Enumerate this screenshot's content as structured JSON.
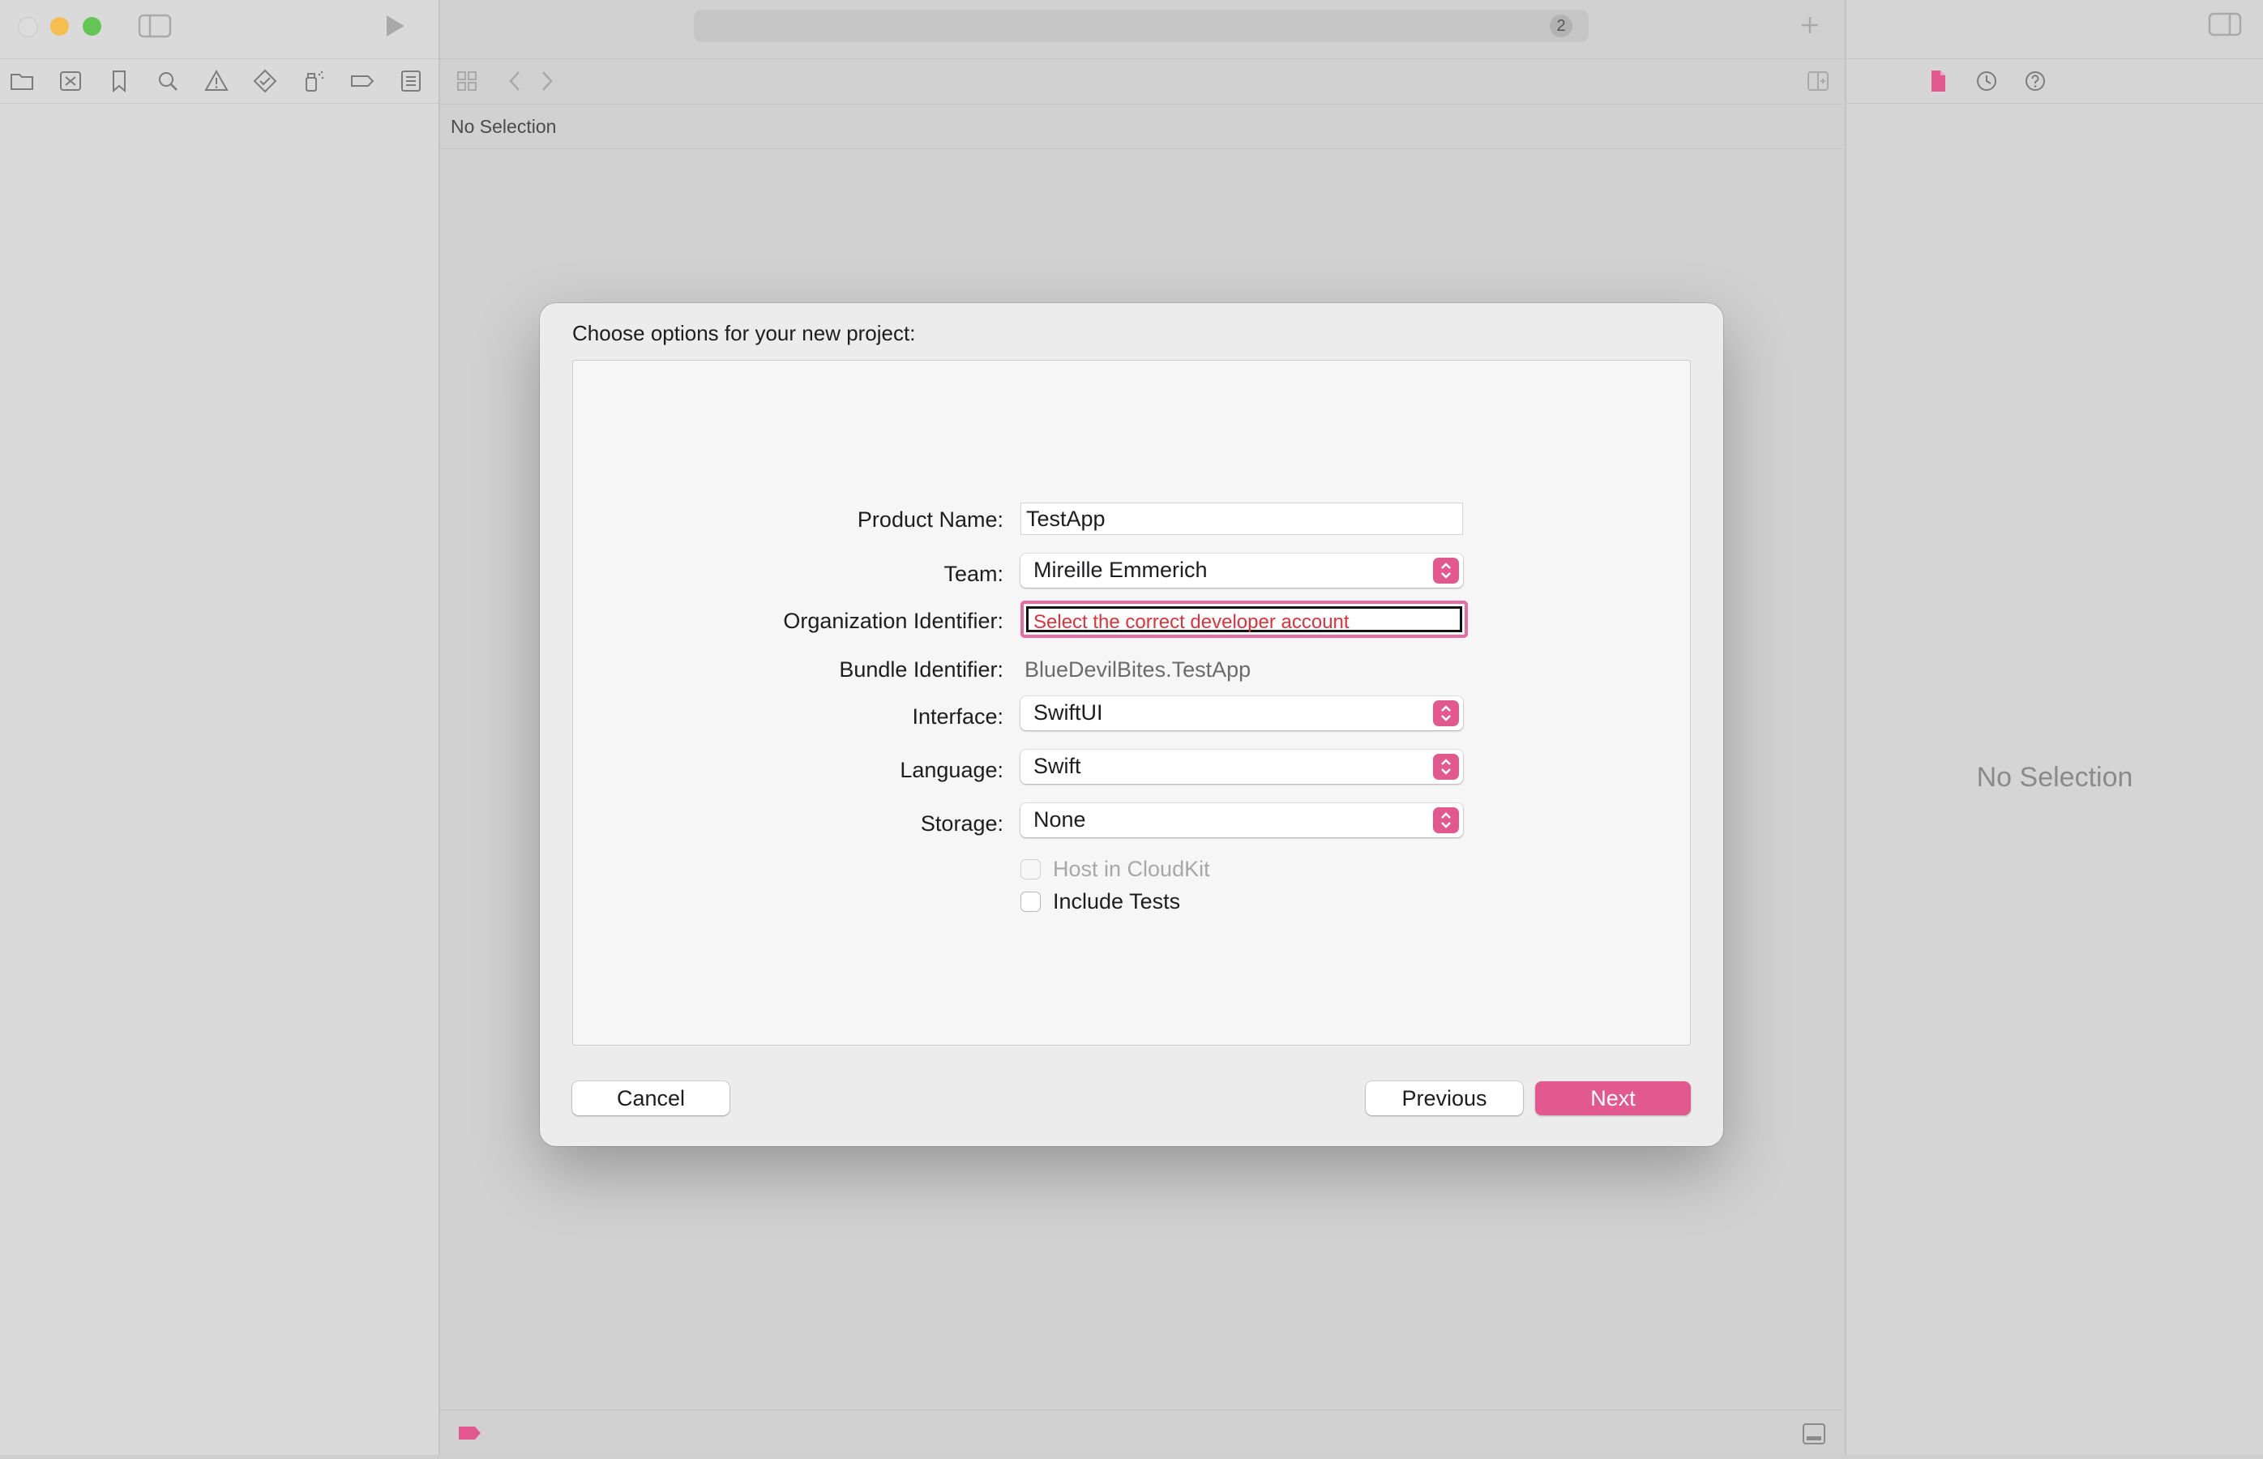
{
  "window": {
    "activity_badge": "2",
    "jump_bar_text": "No Selection"
  },
  "inspector": {
    "empty_text": "No Selection"
  },
  "dialog": {
    "title": "Choose options for your new project:",
    "fields": {
      "product_name": {
        "label": "Product Name:",
        "value": "TestApp"
      },
      "team": {
        "label": "Team:",
        "value": "Mireille Emmerich"
      },
      "organization_identifier": {
        "label": "Organization Identifier:",
        "value": "Select the correct developer account"
      },
      "bundle_identifier": {
        "label": "Bundle Identifier:",
        "value": "BlueDevilBites.TestApp"
      },
      "interface": {
        "label": "Interface:",
        "value": "SwiftUI"
      },
      "language": {
        "label": "Language:",
        "value": "Swift"
      },
      "storage": {
        "label": "Storage:",
        "value": "None"
      }
    },
    "checkboxes": {
      "host_in_cloudkit": {
        "label": "Host in CloudKit",
        "checked": false,
        "enabled": false
      },
      "include_tests": {
        "label": "Include Tests",
        "checked": false,
        "enabled": true
      }
    },
    "buttons": {
      "cancel": "Cancel",
      "previous": "Previous",
      "next": "Next"
    }
  },
  "colors": {
    "accent": "#e2598f",
    "error_text": "#e0323a",
    "traffic_close": "#dcdcdc",
    "traffic_minimize": "#f6be4f",
    "traffic_zoom": "#62c554"
  }
}
